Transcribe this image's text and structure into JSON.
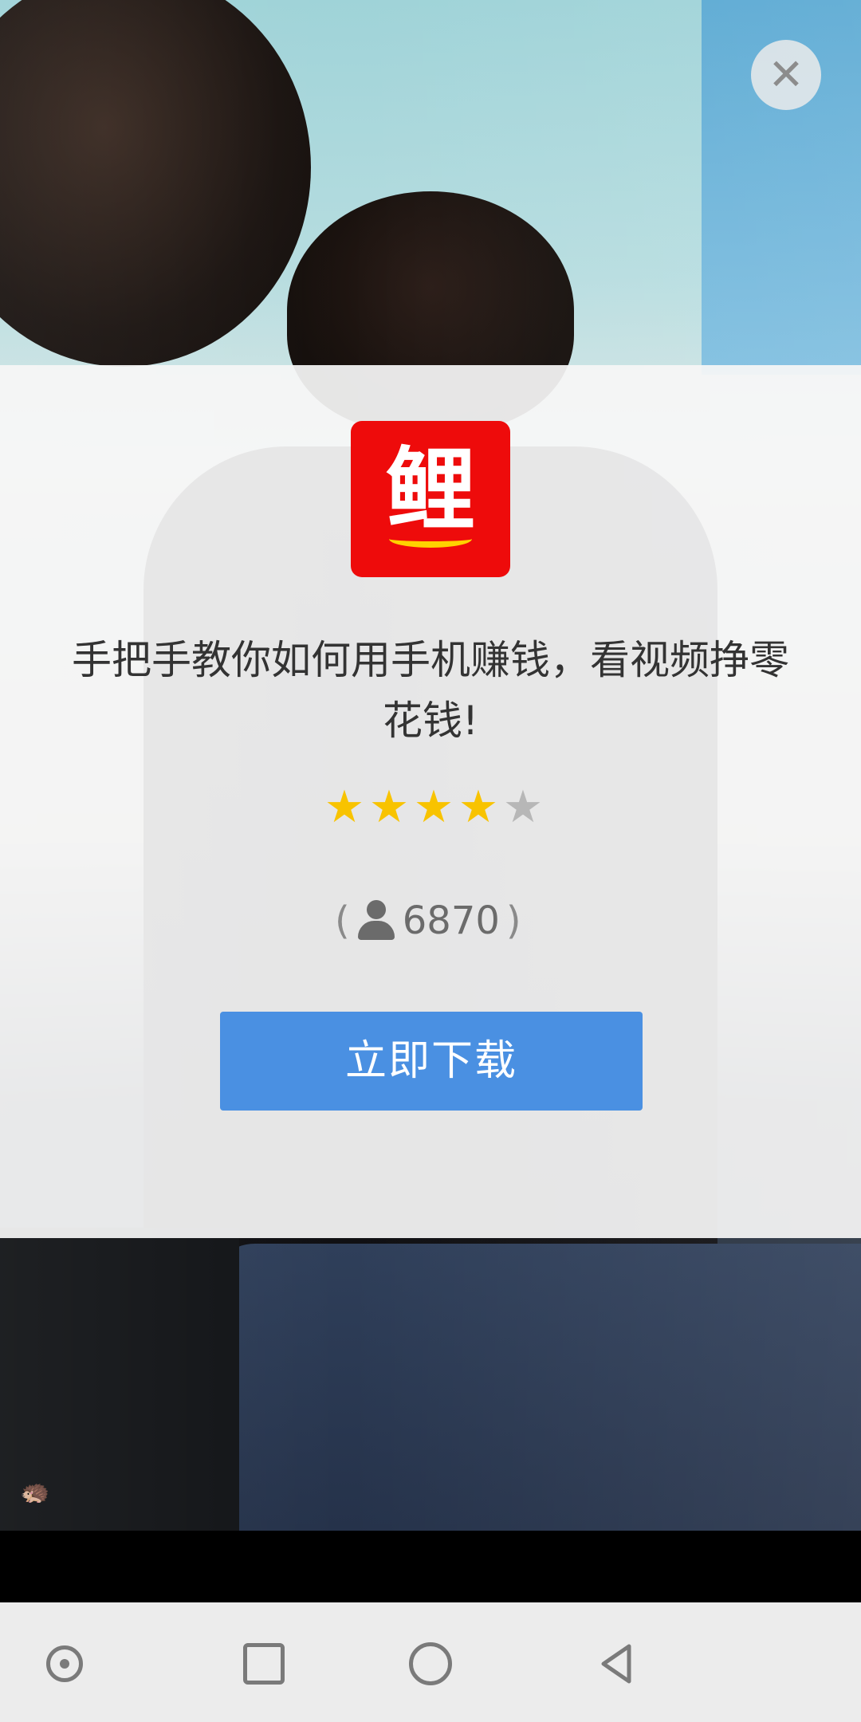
{
  "ad": {
    "app_icon_glyph": "鲤",
    "title": "手把手教你如何用手机赚钱，看视频挣零花钱!",
    "rating": {
      "filled": 4,
      "total": 5
    },
    "count_open": "(",
    "count": "6870",
    "count_close": ")",
    "download_label": "立即下载",
    "close_glyph": "✕"
  },
  "video": {
    "watermark_glyph": "🦔"
  },
  "nav": {
    "items": [
      "assistant-dot",
      "recents",
      "home",
      "back"
    ]
  },
  "colors": {
    "accent_button": "#4a90e2",
    "app_icon_bg": "#ee0b0b",
    "star_on": "#f8c300",
    "star_off": "#b7b7b7"
  }
}
